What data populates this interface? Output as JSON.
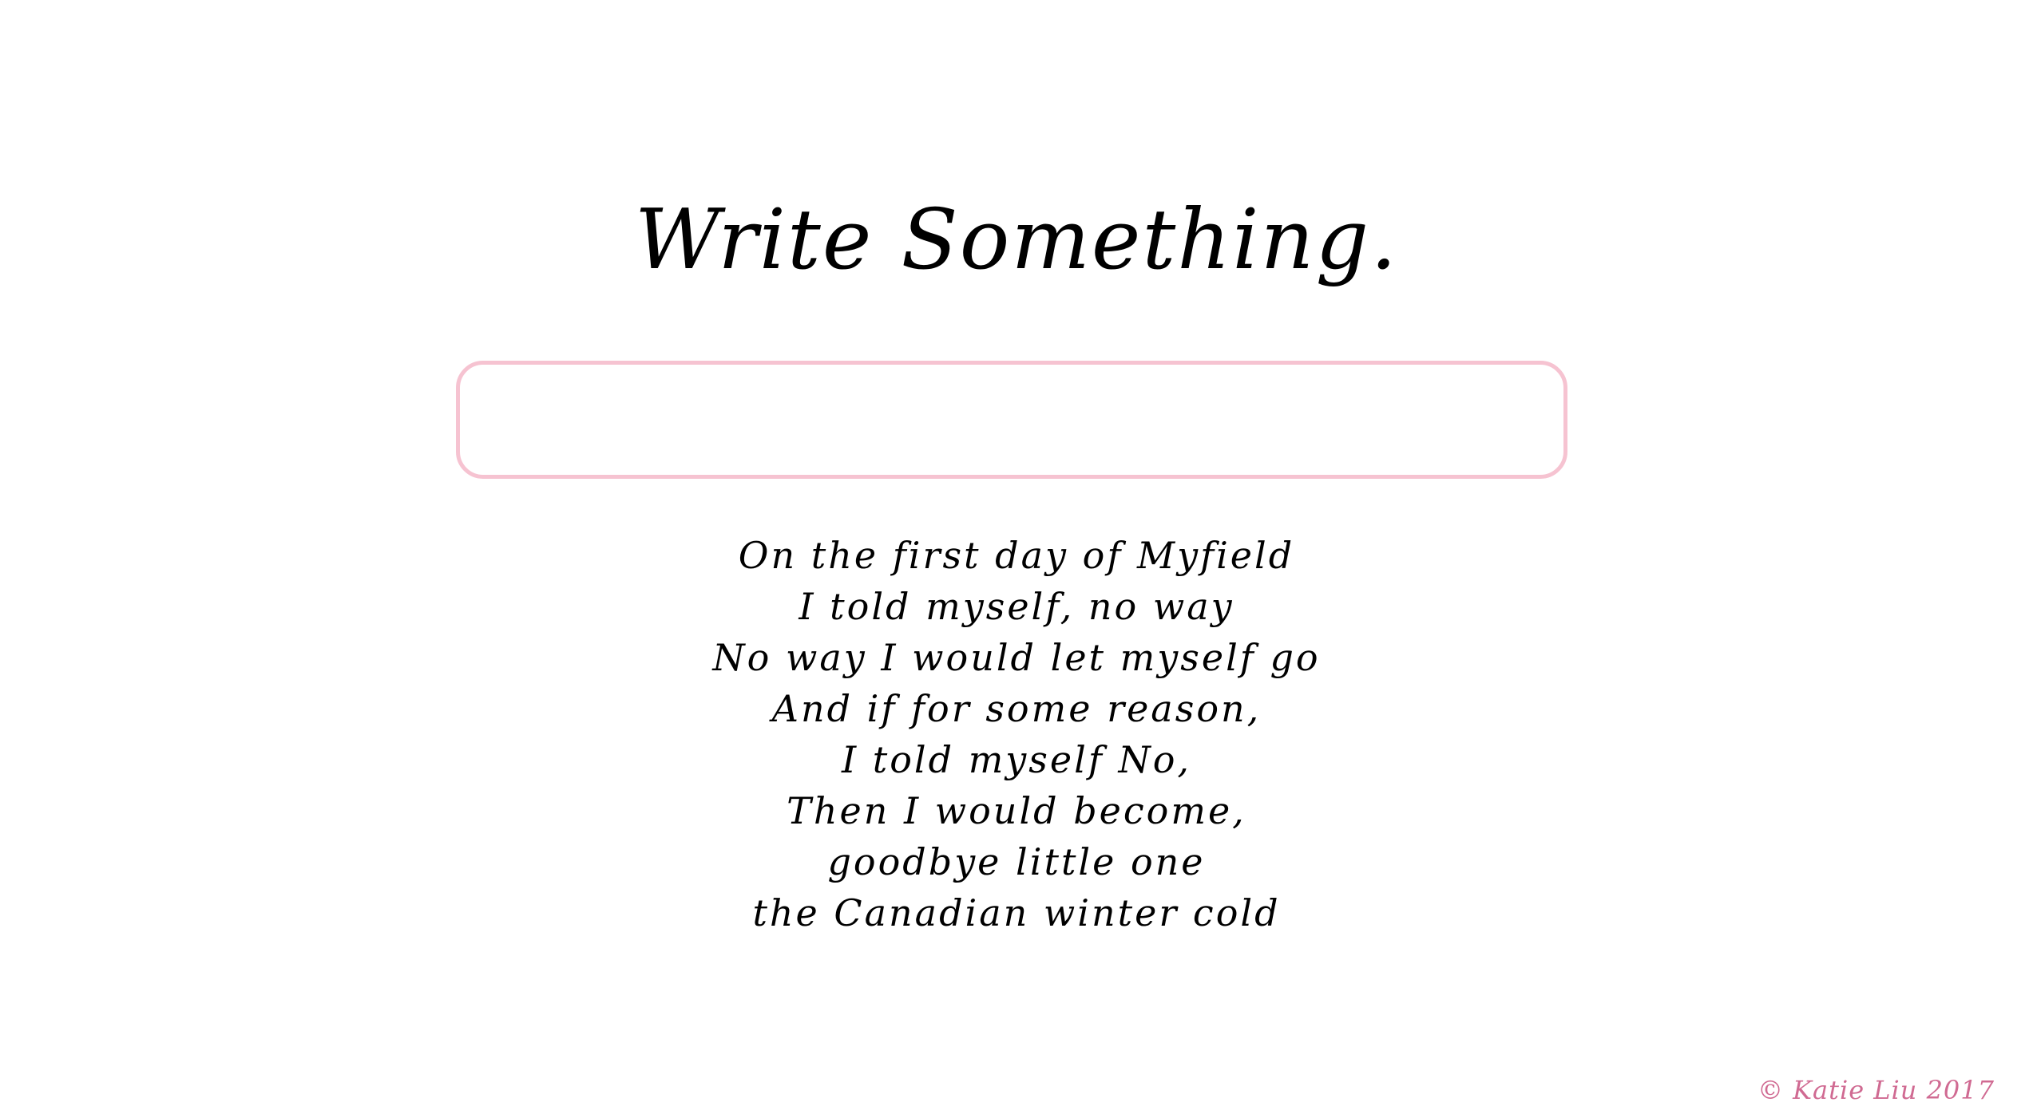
{
  "header": {
    "title": "Write Something."
  },
  "input": {
    "value": "",
    "placeholder": ""
  },
  "poem": {
    "lines": [
      "On the first day of Myfield",
      "I told myself, no way",
      "No way I would let myself go",
      "And if for some reason,",
      "I told myself No,",
      "Then I would become,",
      "goodbye little one",
      "the Canadian winter cold"
    ]
  },
  "footer": {
    "copyright": "© Katie Liu 2017"
  },
  "colors": {
    "input_border": "#f6c3d1",
    "copyright_text": "#d06a92",
    "text": "#000000",
    "background": "#ffffff"
  }
}
